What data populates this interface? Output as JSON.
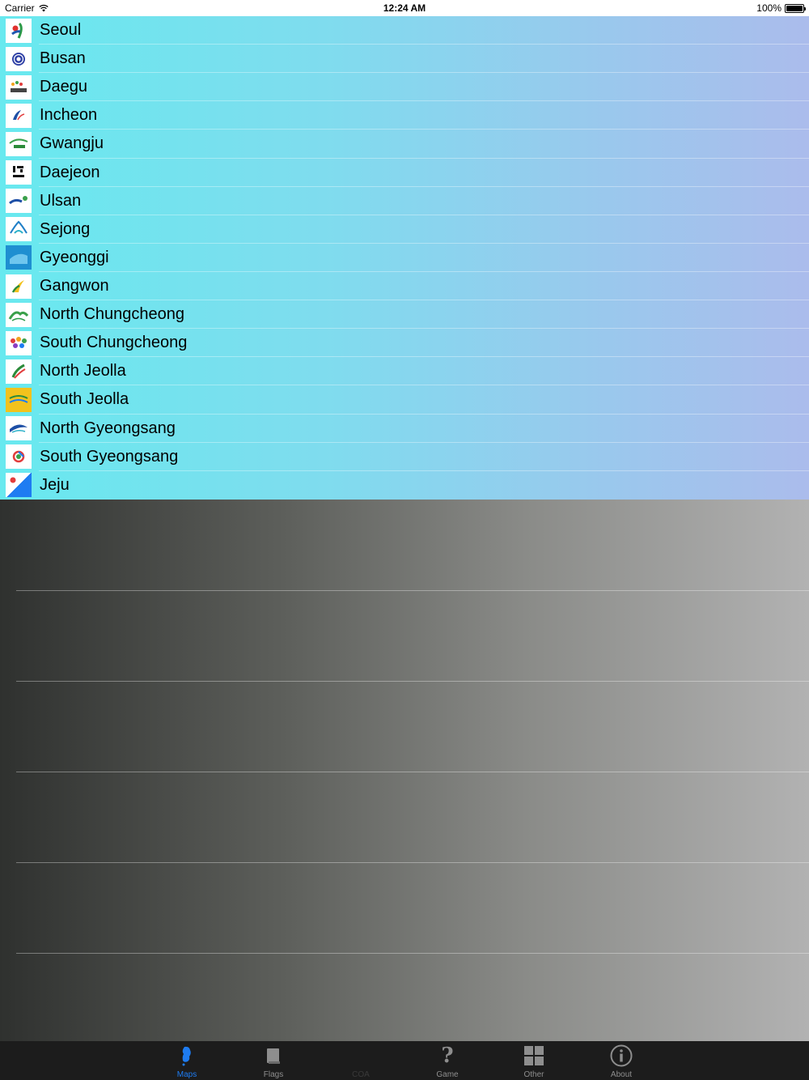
{
  "status_bar": {
    "carrier": "Carrier",
    "time": "12:24 AM",
    "battery": "100%"
  },
  "cities": [
    {
      "name": "Seoul",
      "icon": "seoul-emblem-icon"
    },
    {
      "name": "Busan",
      "icon": "busan-emblem-icon"
    },
    {
      "name": "Daegu",
      "icon": "daegu-emblem-icon"
    },
    {
      "name": "Incheon",
      "icon": "incheon-emblem-icon"
    },
    {
      "name": "Gwangju",
      "icon": "gwangju-emblem-icon"
    },
    {
      "name": "Daejeon",
      "icon": "daejeon-emblem-icon"
    },
    {
      "name": "Ulsan",
      "icon": "ulsan-emblem-icon"
    },
    {
      "name": "Sejong",
      "icon": "sejong-emblem-icon"
    },
    {
      "name": "Gyeonggi",
      "icon": "gyeonggi-emblem-icon"
    },
    {
      "name": "Gangwon",
      "icon": "gangwon-emblem-icon"
    },
    {
      "name": "North Chungcheong",
      "icon": "north-chungcheong-emblem-icon"
    },
    {
      "name": "South Chungcheong",
      "icon": "south-chungcheong-emblem-icon"
    },
    {
      "name": "North Jeolla",
      "icon": "north-jeolla-emblem-icon"
    },
    {
      "name": "South Jeolla",
      "icon": "south-jeolla-emblem-icon"
    },
    {
      "name": "North Gyeongsang",
      "icon": "north-gyeongsang-emblem-icon"
    },
    {
      "name": "South Gyeongsang",
      "icon": "south-gyeongsang-emblem-icon"
    },
    {
      "name": "Jeju",
      "icon": "jeju-emblem-icon"
    }
  ],
  "tabs": [
    {
      "label": "Maps",
      "icon": "korea-map-icon",
      "active": true
    },
    {
      "label": "Flags",
      "icon": "flag-book-icon",
      "active": false
    },
    {
      "label": "COA",
      "icon": "coat-of-arms-icon",
      "active": false
    },
    {
      "label": "Game",
      "icon": "question-mark-icon",
      "active": false
    },
    {
      "label": "Other",
      "icon": "grid-icon",
      "active": false
    },
    {
      "label": "About",
      "icon": "info-icon",
      "active": false
    }
  ],
  "colors": {
    "accent": "#1e7cf2",
    "list_gradient_start": "#68e9ef",
    "list_gradient_end": "#abbcec",
    "tab_bar": "#1c1c1c"
  }
}
